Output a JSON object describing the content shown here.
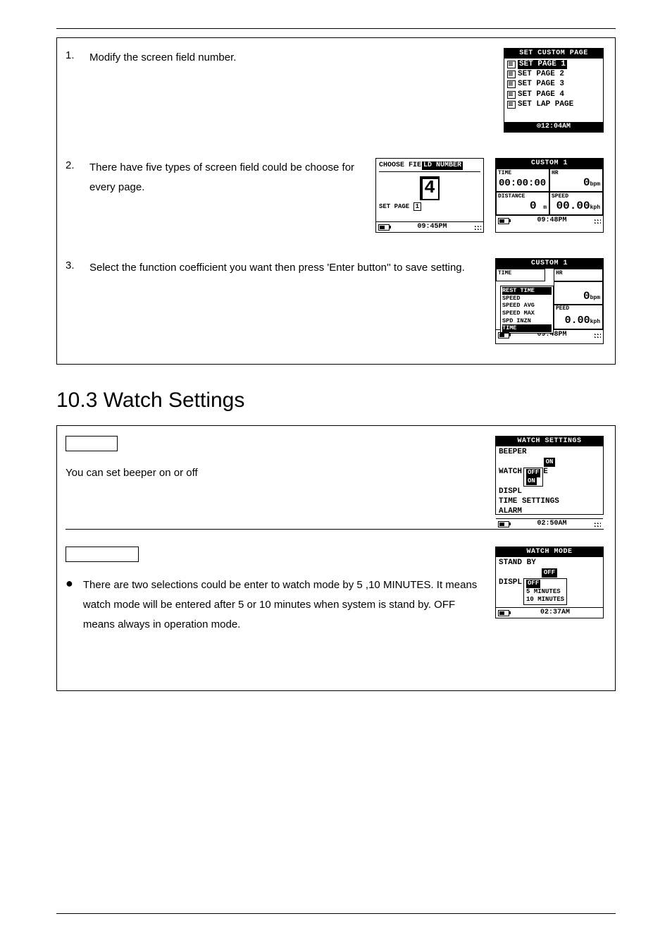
{
  "heading": "10.3 Watch Settings",
  "box1": {
    "steps": [
      {
        "n": "1.",
        "text": "Modify the screen field number."
      },
      {
        "n": "2.",
        "text": "There have five types of screen field could be choose for every page."
      },
      {
        "n": "3.",
        "text": "Select the function coefficient you want then press 'Enter button'' to save setting."
      }
    ],
    "screens": {
      "menu": {
        "title": "SET CUSTOM PAGE",
        "items": [
          "SET PAGE 1",
          "SET PAGE 2",
          "SET PAGE 3",
          "SET PAGE 4",
          "SET LAP PAGE"
        ],
        "time": "⊙12:04AM"
      },
      "field": {
        "header_a": "CHOOSE FIE",
        "header_b": "LD NUMBER",
        "value": "4",
        "label": "SET PAGE",
        "page": "1",
        "time": "09:45PM"
      },
      "custom": {
        "title": "CUSTOM 1",
        "cells": [
          {
            "l": "TIME",
            "v": "00:00:00",
            "u": ""
          },
          {
            "l": "HR",
            "v": "0",
            "u": "bpm"
          },
          {
            "l": "DISTANCE",
            "v": "0",
            "u": "m"
          },
          {
            "l": "SPEED",
            "v": "00.00",
            "u": "kph"
          }
        ],
        "time": "09:48PM"
      },
      "popup": {
        "title": "CUSTOM 1",
        "bg": [
          "TIME",
          "HR",
          "PEED"
        ],
        "hr_v": "0",
        "hr_u": "bpm",
        "sp_v": "0.00",
        "sp_u": "kph",
        "items": [
          "REST TIME",
          "SPEED",
          "SPEED AVG",
          "SPEED MAX",
          "SPD INZN",
          "TIME"
        ],
        "time": "09:48PM"
      }
    }
  },
  "box2": {
    "beeper": {
      "text": "You can set beeper on or off",
      "screen": {
        "title": "WATCH SETTINGS",
        "lines": [
          "BEEPER",
          "WATCH",
          "DISPL",
          "TIME SETTINGS",
          "ALARM"
        ],
        "on": "ON",
        "off": "OFF",
        "tail1": "E",
        "time": "02:50AM"
      }
    },
    "watchmode": {
      "text": "There are two selections could be enter to watch mode by 5 ,10 MINUTES. It means watch mode will be entered after 5 or 10 minutes when system is stand by. OFF means always in operation mode.",
      "screen": {
        "title": "WATCH MODE",
        "lines": [
          "STAND BY",
          "DISPL"
        ],
        "sel": "OFF",
        "opts": [
          "OFF",
          " 5 MINUTES",
          "10 MINUTES"
        ],
        "time": "02:37AM"
      }
    }
  }
}
